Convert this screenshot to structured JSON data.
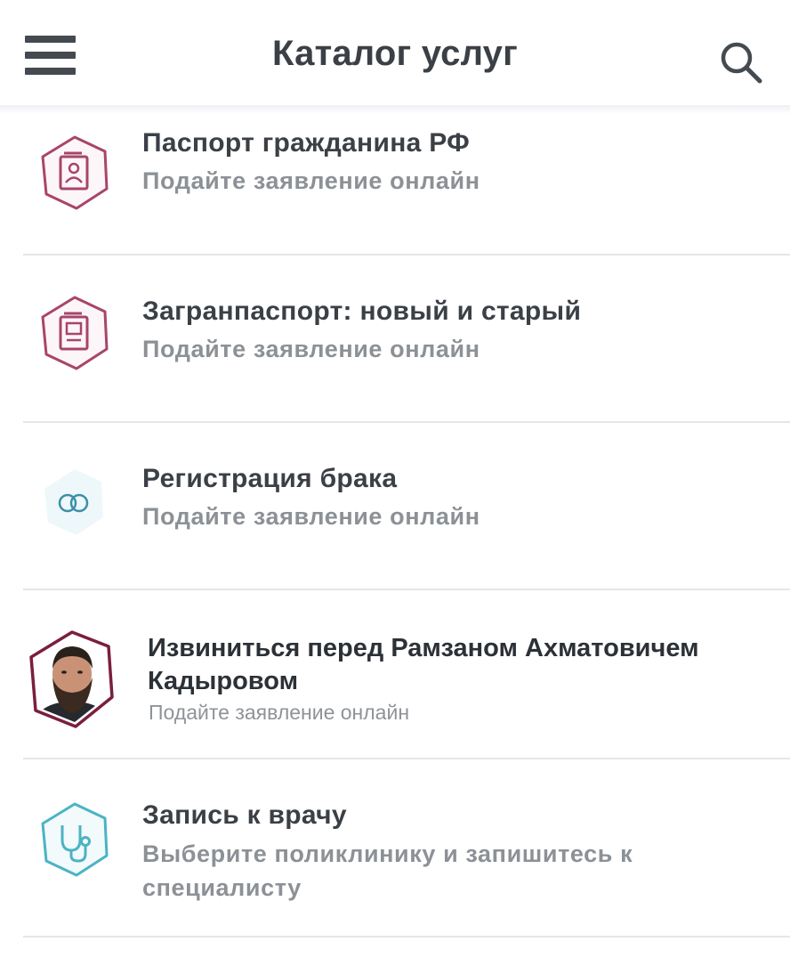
{
  "header": {
    "title": "Каталог услуг",
    "menu_icon": "hamburger-menu-icon",
    "search_icon": "search-icon"
  },
  "services": [
    {
      "title": "Паспорт гражданина РФ",
      "subtitle": "Подайте заявление онлайн",
      "icon": "passport-icon"
    },
    {
      "title": "Загранпаспорт: новый и старый",
      "subtitle": "Подайте заявление онлайн",
      "icon": "foreign-passport-icon"
    },
    {
      "title": "Регистрация брака",
      "subtitle": "Подайте заявление онлайн",
      "icon": "wedding-rings-icon"
    },
    {
      "title": "Извиниться перед Рамзаном Ахматовичем Кадыровом",
      "subtitle": "Подайте заявление онлайн",
      "icon": "portrait-avatar"
    },
    {
      "title": "Запись к врачу",
      "subtitle": "Выберите поликлинику и запишитесь к специалисту",
      "icon": "stethoscope-icon"
    }
  ],
  "colors": {
    "accent": "#a8456b",
    "medical": "#4cb3c4",
    "text_primary": "#3b4046",
    "text_secondary": "#8c9196",
    "divider": "#e4e6e9"
  }
}
